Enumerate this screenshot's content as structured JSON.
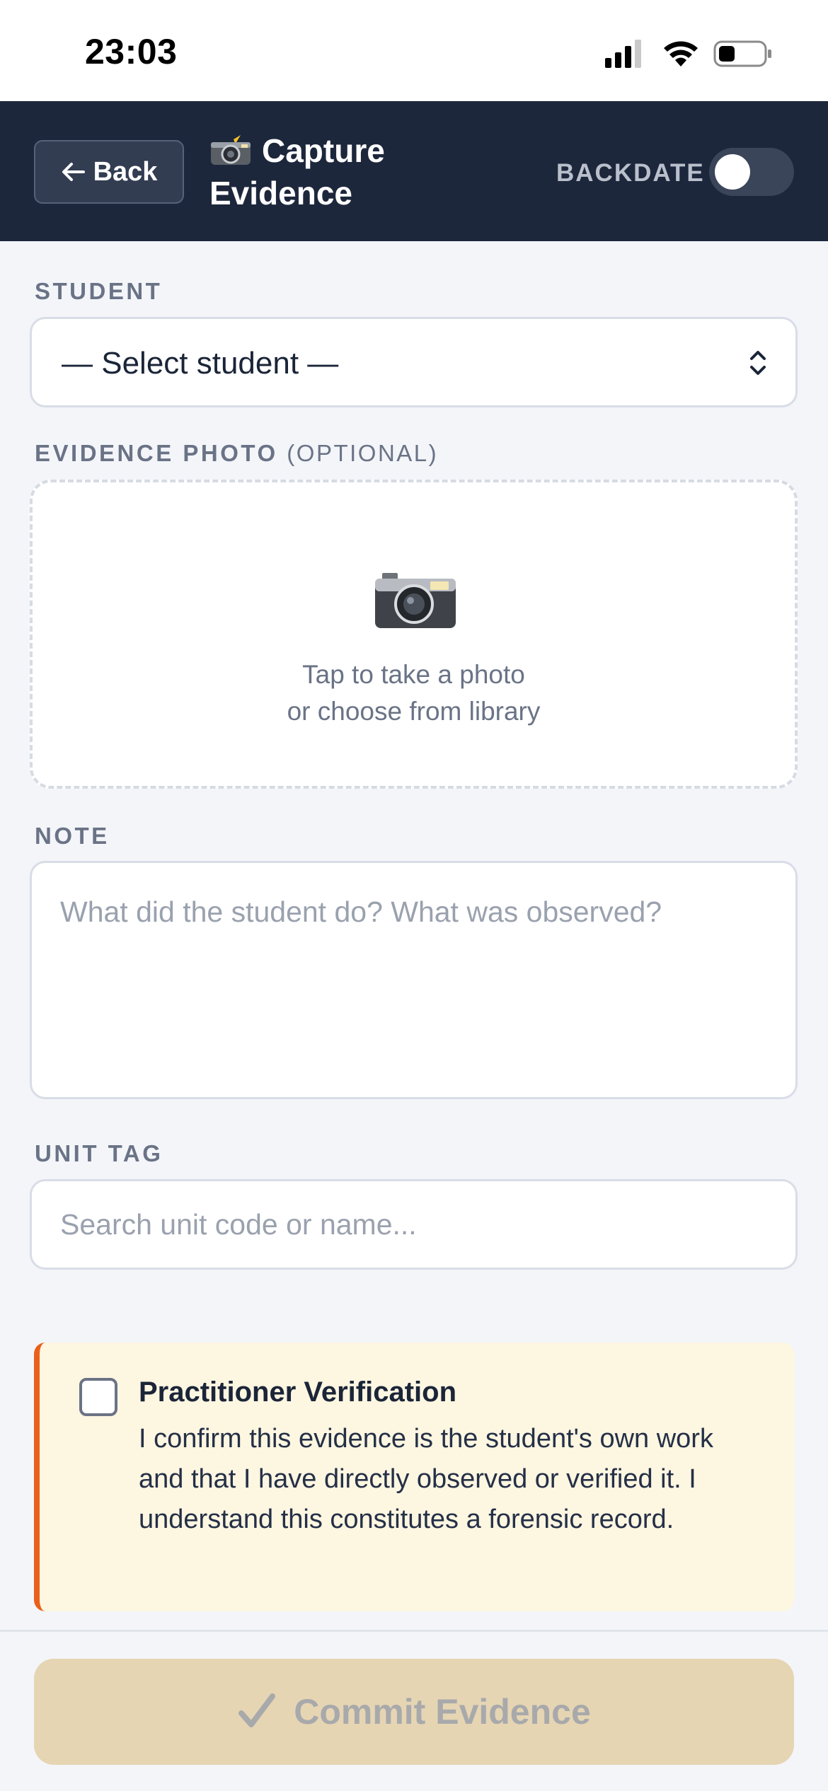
{
  "status_bar": {
    "time": "23:03"
  },
  "header": {
    "back_label": "Back",
    "title": "Capture Evidence",
    "backdate_label": "BACKDATE",
    "backdate_on": false
  },
  "form": {
    "student": {
      "label": "STUDENT",
      "selected": "— Select student —"
    },
    "photo": {
      "label": "EVIDENCE PHOTO",
      "optional_label": "(OPTIONAL)",
      "hint_line1": "Tap to take a photo",
      "hint_line2": "or choose from library"
    },
    "note": {
      "label": "NOTE",
      "placeholder": "What did the student do? What was observed?",
      "value": ""
    },
    "unit_tag": {
      "label": "UNIT TAG",
      "placeholder": "Search unit code or name...",
      "value": ""
    },
    "verification": {
      "title": "Practitioner Verification",
      "text": "I confirm this evidence is the student's own work and that I have directly observed or verified it. I understand this constitutes a forensic record.",
      "checked": false
    }
  },
  "actions": {
    "commit_label": "Commit Evidence"
  },
  "colors": {
    "header_bg": "#1d273c",
    "accent_orange": "#e9601a",
    "verify_bg": "#fdf6e1",
    "commit_disabled_bg": "#e6d5b3"
  },
  "icons": {
    "back": "arrow-left-icon",
    "title": "camera-flash-icon",
    "select": "chevron-updown-icon",
    "photo": "camera-icon",
    "commit": "checkmark-icon"
  }
}
